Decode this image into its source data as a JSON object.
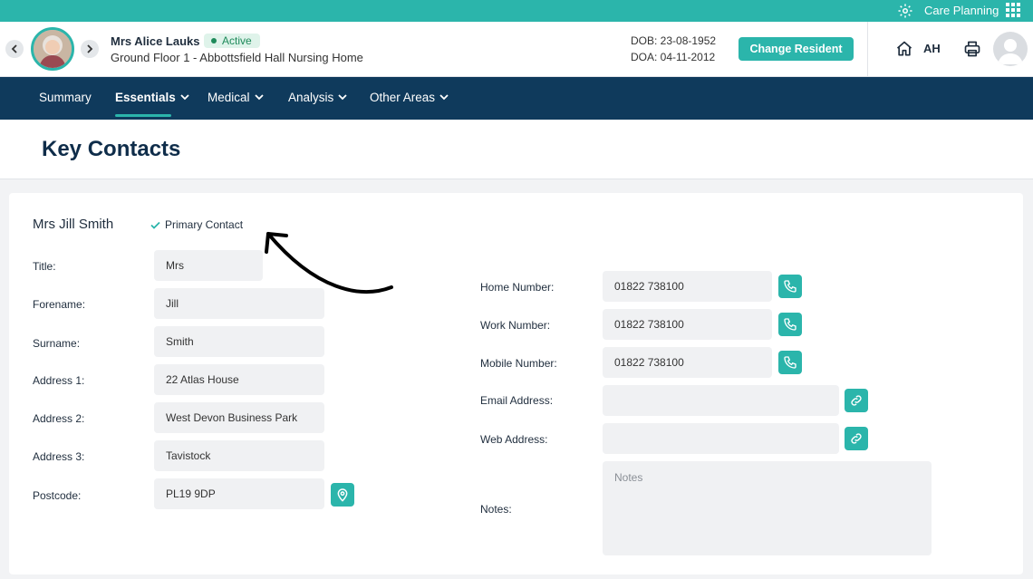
{
  "topbar": {
    "app_label": "Care Planning",
    "gear_icon": "gear-icon",
    "apps_icon": "grid-icon"
  },
  "resident": {
    "name": "Mrs Alice Lauks",
    "status": "Active",
    "location": "Ground Floor 1 - Abbottsfield Hall Nursing Home",
    "dob": "DOB: 23-08-1952",
    "doa": "DOA: 04-11-2012"
  },
  "header": {
    "change_resident_label": "Change Resident",
    "initials": "AH",
    "home_icon": "home-icon",
    "print_icon": "printer-icon"
  },
  "nav": {
    "items": [
      {
        "label": "Summary"
      },
      {
        "label": "Essentials"
      },
      {
        "label": "Medical"
      },
      {
        "label": "Analysis"
      },
      {
        "label": "Other Areas"
      }
    ],
    "active": "Essentials"
  },
  "page": {
    "title": "Key Contacts"
  },
  "contact": {
    "name": "Mrs Jill Smith",
    "primary_label": "Primary Contact",
    "left_fields": [
      {
        "label": "Title:",
        "value": "Mrs"
      },
      {
        "label": "Forename:",
        "value": "Jill"
      },
      {
        "label": "Surname:",
        "value": "Smith"
      },
      {
        "label": "Address 1:",
        "value": "22 Atlas House"
      },
      {
        "label": "Address 2:",
        "value": "West Devon Business Park"
      },
      {
        "label": "Address 3:",
        "value": "Tavistock"
      },
      {
        "label": "Postcode:",
        "value": "PL19 9DP"
      }
    ],
    "right_fields": [
      {
        "label": "Home Number:",
        "value": "01822 738100"
      },
      {
        "label": "Work Number:",
        "value": "01822 738100"
      },
      {
        "label": "Mobile Number:",
        "value": "01822 738100"
      },
      {
        "label": "Email Address:",
        "value": ""
      },
      {
        "label": "Web Address:",
        "value": ""
      }
    ],
    "notes_label": "Notes:",
    "notes_placeholder": "Notes"
  },
  "colors": {
    "teal": "#2bb5ab",
    "navy": "#0f3a5c",
    "field_bg": "#f0f1f3"
  }
}
